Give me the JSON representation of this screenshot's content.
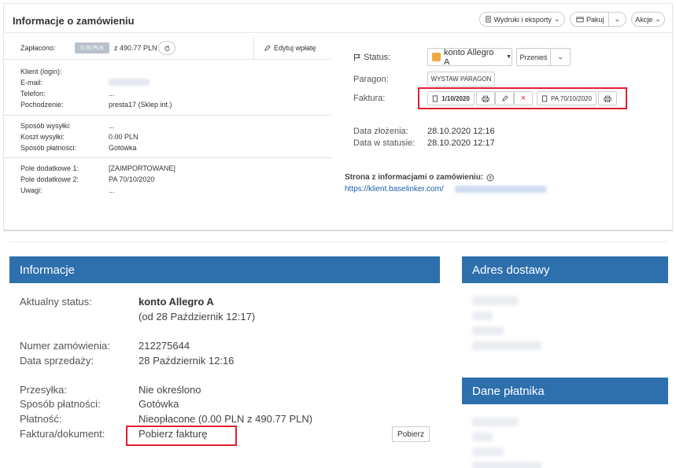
{
  "header": {
    "title": "Informacje o zamówieniu",
    "prints_label": "Wydruki i eksporty",
    "pack_label": "Pakuj",
    "actions_label": "Akcje"
  },
  "payment": {
    "label": "Zapłacono:",
    "paid_badge": "0.00 PLN",
    "total": "z 490.77 PLN",
    "edit_label": "Edytuj wpłatę"
  },
  "client": {
    "login_label": "Klient (login):",
    "email_label": "E-mail:",
    "phone_label": "Telefon:",
    "phone_value": "...",
    "origin_label": "Pochodzenie:",
    "origin_value": "presta17 (Sklep int.)"
  },
  "shipping": {
    "method_label": "Sposób wysyłki:",
    "method_value": "...",
    "cost_label": "Koszt wysyłki:",
    "cost_value": "0.00 PLN",
    "pay_method_label": "Sposób płatności:",
    "pay_method_value": "Gotówka"
  },
  "extra": {
    "field1_label": "Pole dodatkowe 1:",
    "field1_value": "[ZAIMPORTOWANE]",
    "field2_label": "Pole dodatkowe 2:",
    "field2_value": "PA 70/10/2020",
    "notes_label": "Uwagi:",
    "notes_value": "..."
  },
  "status": {
    "label": "Status:",
    "value": "konto Allegro A",
    "color": "#f0a941",
    "move_label": "Przenieś"
  },
  "receipt": {
    "label": "Paragon:",
    "button": "WYSTAW PARAGON"
  },
  "invoice": {
    "label": "Faktura:",
    "number": "1/10/2020",
    "receipt_number": "PA 70/10/2020"
  },
  "dates": {
    "created_label": "Data złożenia:",
    "created_value": "28.10.2020 12:16",
    "status_label": "Data w statusie:",
    "status_value": "28.10.2020 12:17"
  },
  "info_page": {
    "label": "Strona z informacjami o zamówieniu:",
    "url": "https://klient.baselinker.com/"
  },
  "info_panel": {
    "title": "Informacje",
    "current_status_label": "Aktualny status:",
    "current_status_value": "konto Allegro A",
    "since": "(od 28 Październik 12:17)",
    "order_no_label": "Numer zamówienia:",
    "order_no_value": "212275644",
    "sale_date_label": "Data sprzedaży:",
    "sale_date_value": "28 Październik 12:16",
    "shipment_label": "Przesyłka:",
    "shipment_value": "Nie określono",
    "payment_method_label": "Sposób płatności:",
    "payment_method_value": "Gotówka",
    "payment_label": "Płatność:",
    "payment_value": "Nieopłacone (0.00 PLN z 490.77 PLN)",
    "invoice_doc_label": "Faktura/dokument:",
    "invoice_doc_link": "Pobierz fakturę",
    "download_button": "Pobierz"
  },
  "delivery_panel": {
    "title": "Adres dostawy"
  },
  "payer_panel": {
    "title": "Dane płatnika"
  },
  "colors": {
    "accent": "#2e6fad",
    "link": "#1a5fa8",
    "highlight": "#e01e2f"
  }
}
